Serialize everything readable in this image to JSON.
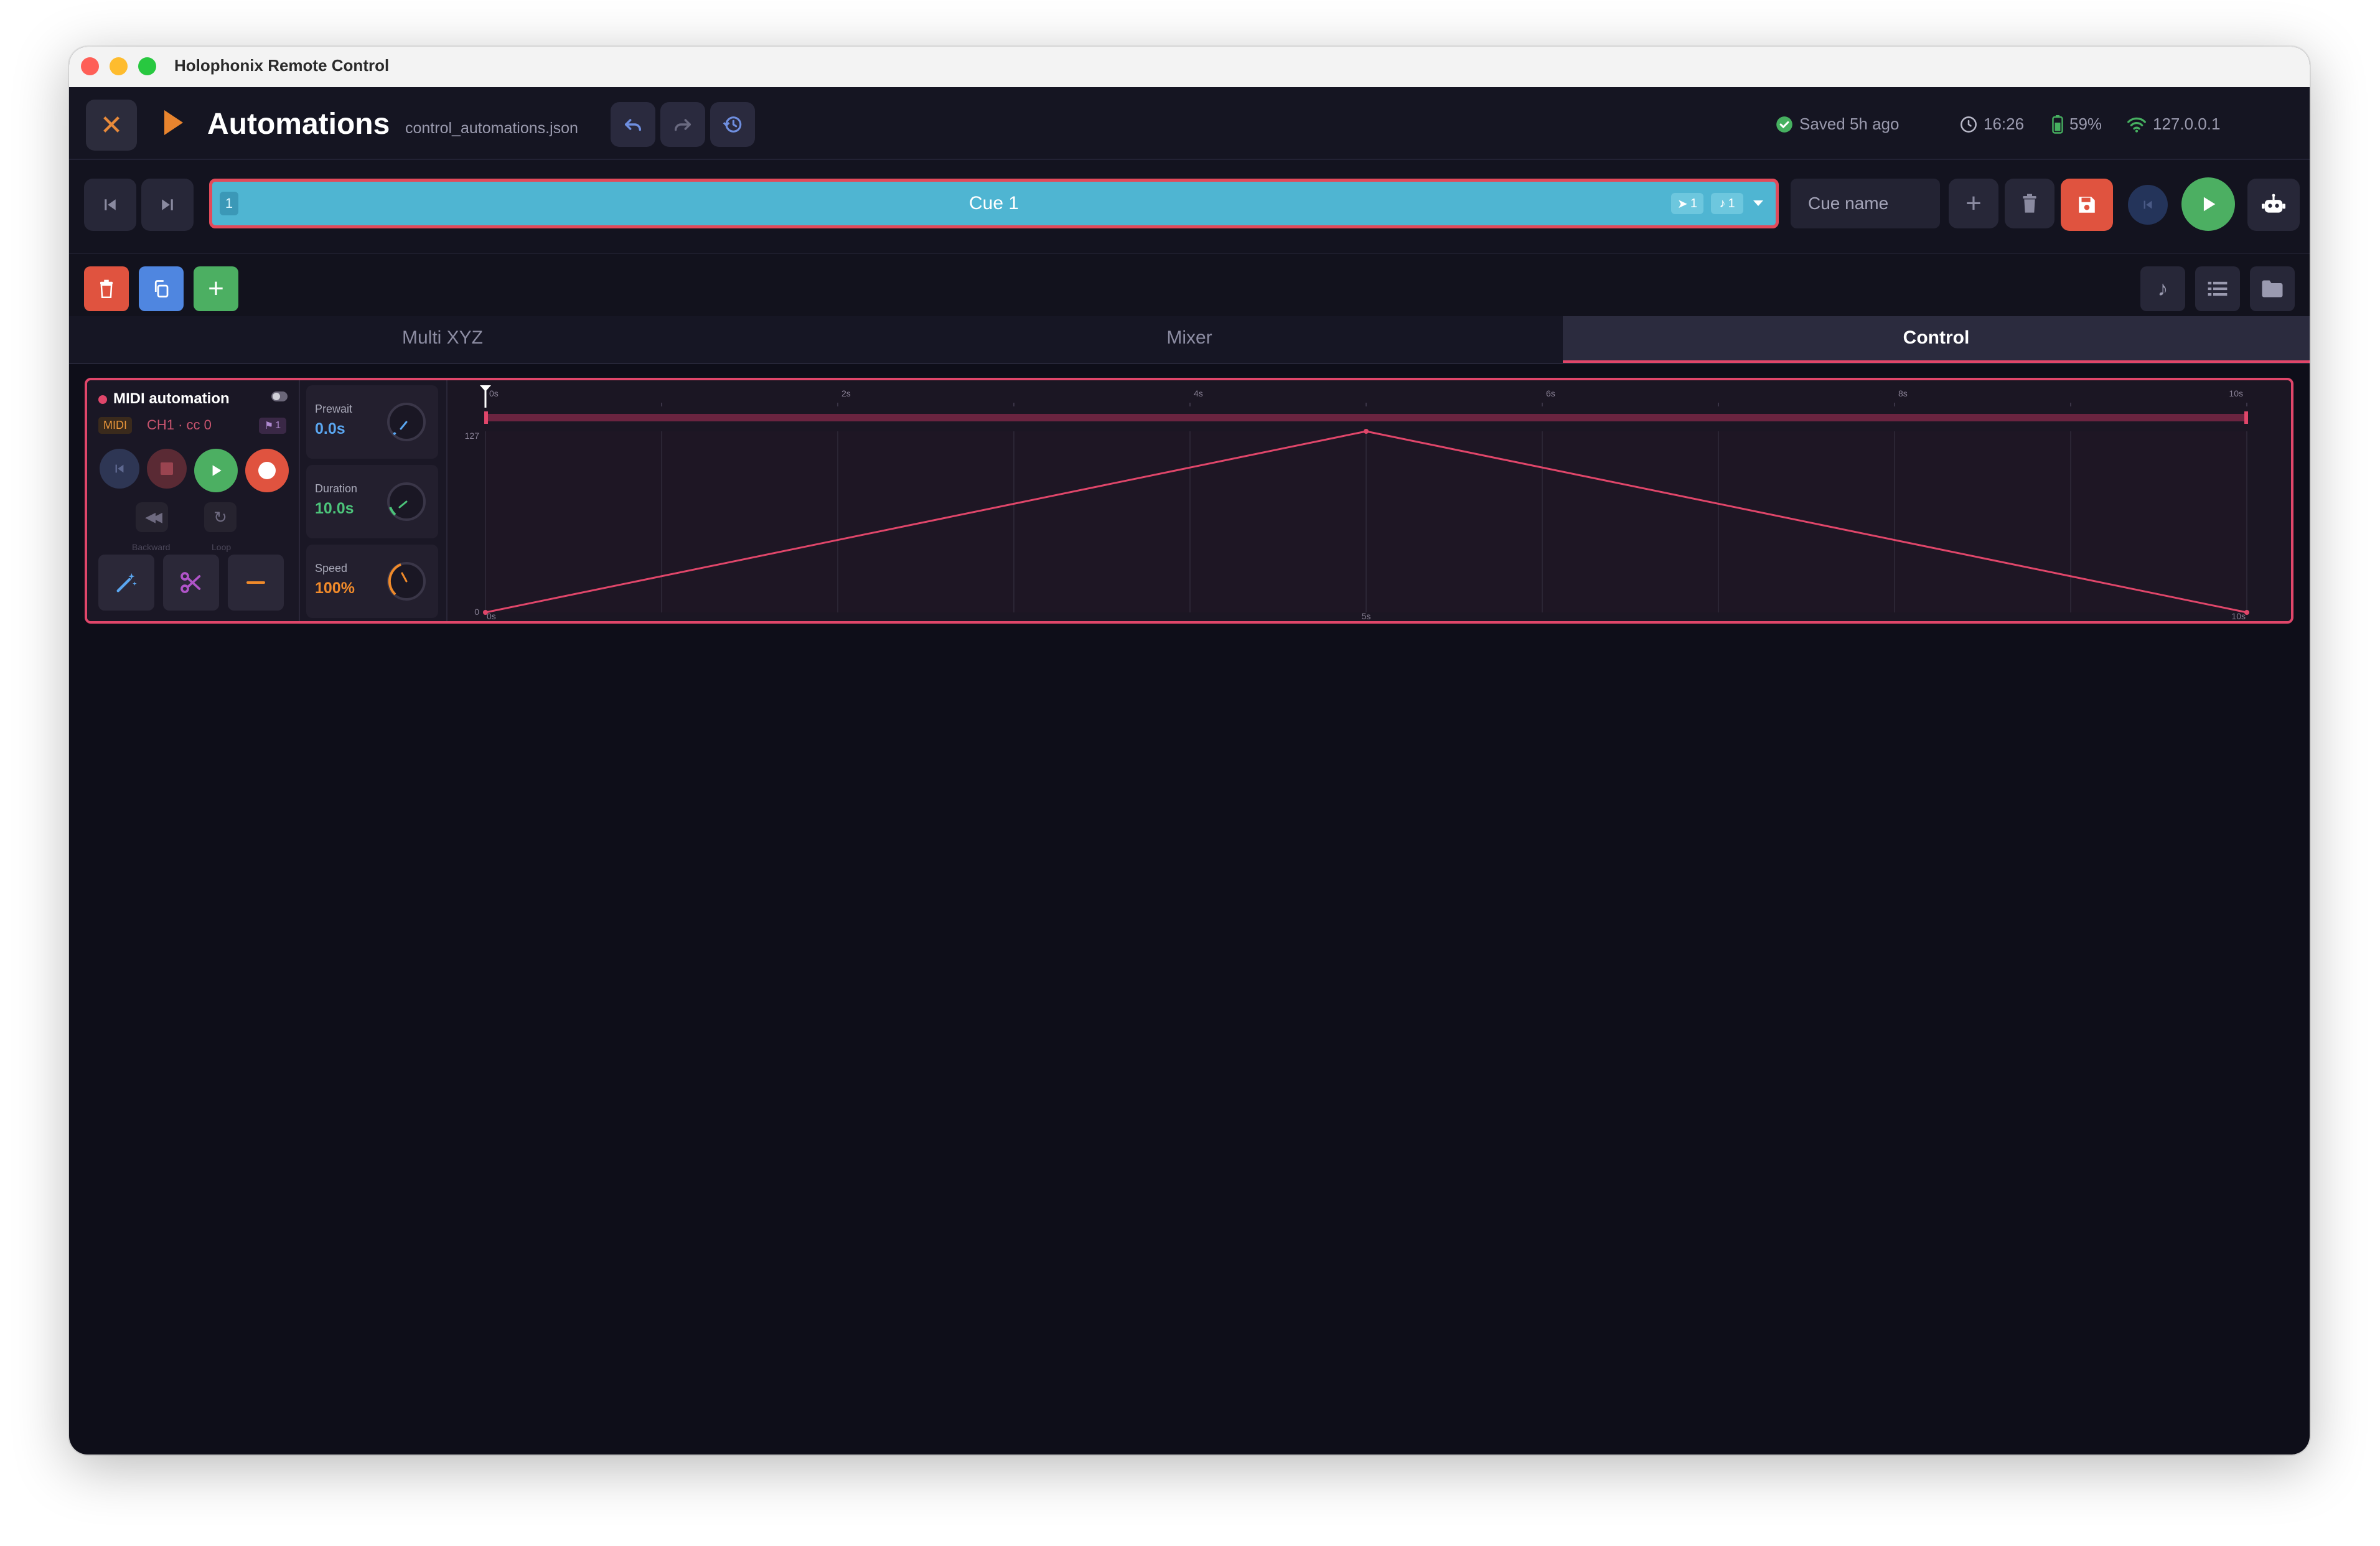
{
  "window": {
    "title": "Holophonix Remote Control"
  },
  "header": {
    "page_title": "Automations",
    "file_name": "control_automations.json",
    "save_status": "Saved 5h ago",
    "clock": "16:26",
    "battery": "59%",
    "ip": "127.0.0.1"
  },
  "cue": {
    "number": "1",
    "label": "Cue 1",
    "chip_tracks": "1",
    "chip_notes": "1",
    "name_placeholder": "Cue name"
  },
  "tabs": [
    {
      "label": "Multi XYZ",
      "active": false
    },
    {
      "label": "Mixer",
      "active": false
    },
    {
      "label": "Control",
      "active": true
    }
  ],
  "automation": {
    "name": "MIDI automation",
    "protocol_badge": "MIDI",
    "address": "CH1 · cc 0",
    "track_count": "1",
    "backward_label": "Backward",
    "loop_label": "Loop",
    "prewait": {
      "label": "Prewait",
      "value": "0.0s"
    },
    "duration": {
      "label": "Duration",
      "value": "10.0s"
    },
    "speed": {
      "label": "Speed",
      "value": "100%"
    }
  },
  "timeline": {
    "ruler_labels": [
      "0s",
      "2s",
      "4s",
      "6s",
      "8s",
      "10s"
    ],
    "bottom_labels": [
      "0s",
      "5s",
      "10s"
    ],
    "y_max_label": "127",
    "y_min_label": "0"
  },
  "chart_data": {
    "type": "line",
    "x": [
      0,
      5,
      10
    ],
    "series": [
      {
        "values": [
          0,
          127,
          0
        ]
      }
    ],
    "xlim": [
      0,
      10
    ],
    "ylim": [
      0,
      127
    ],
    "xticks": [
      "0s",
      "5s",
      "10s"
    ],
    "yticks": [
      "0",
      "127"
    ],
    "grid": true,
    "color": "#e0466a"
  },
  "colors": {
    "accent": "#e0466a",
    "cue_blue": "#4fb5d2",
    "play_green": "#4caf62",
    "record_red": "#e0533f",
    "prewait_blue": "#5aa6f0",
    "duration_green": "#4cc47a",
    "speed_orange": "#f08a2a"
  }
}
